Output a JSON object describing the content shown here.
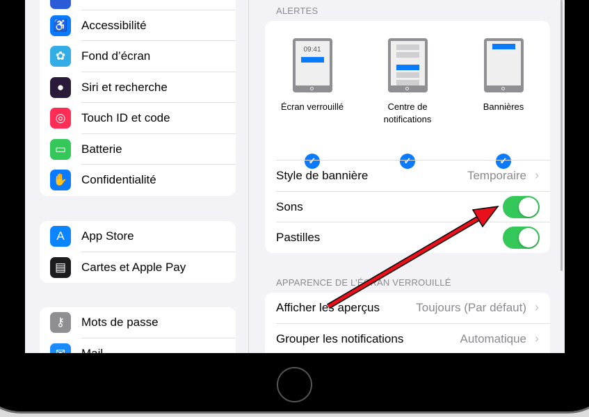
{
  "sidebar": {
    "groups": [
      [
        {
          "label": "Accessibilité",
          "icon": "accessibility-icon",
          "color": "#0a7aff"
        },
        {
          "label": "Fond d’écran",
          "icon": "wallpaper-flower-icon",
          "color": "#32ade6"
        },
        {
          "label": "Siri et recherche",
          "icon": "siri-icon",
          "color": "#2a1a3a"
        },
        {
          "label": "Touch ID et code",
          "icon": "fingerprint-icon",
          "color": "#ff2d55"
        },
        {
          "label": "Batterie",
          "icon": "battery-icon",
          "color": "#34c759"
        },
        {
          "label": "Confidentialité",
          "icon": "hand-icon",
          "color": "#0a7aff"
        }
      ],
      [
        {
          "label": "App Store",
          "icon": "app-store-icon",
          "color": "#0a84ff"
        },
        {
          "label": "Cartes et Apple Pay",
          "icon": "wallet-icon",
          "color": "#1c1c1e"
        }
      ],
      [
        {
          "label": "Mots de passe",
          "icon": "key-icon",
          "color": "#8e8e93"
        },
        {
          "label": "Mail",
          "icon": "mail-icon",
          "color": "#1a8cff"
        }
      ]
    ]
  },
  "detail": {
    "alerts_header": "ALERTES",
    "options": [
      {
        "label": "Écran verrouillé",
        "time": "09:41",
        "checked": true
      },
      {
        "label": "Centre de notifications",
        "checked": true
      },
      {
        "label": "Bannières",
        "checked": true
      }
    ],
    "banner_style": {
      "label": "Style de bannière",
      "value": "Temporaire"
    },
    "sounds": {
      "label": "Sons",
      "on": true
    },
    "badges": {
      "label": "Pastilles",
      "on": true
    },
    "lock_header": "APPARENCE DE L’ÉCRAN VERROUILLÉ",
    "previews": {
      "label": "Afficher les aperçus",
      "value": "Toujours (Par défaut)"
    },
    "grouping": {
      "label": "Grouper les notifications",
      "value": "Automatique"
    }
  },
  "colors": {
    "accent": "#0a7aff",
    "toggle_on": "#34c759",
    "arrow": "#e8101a"
  }
}
